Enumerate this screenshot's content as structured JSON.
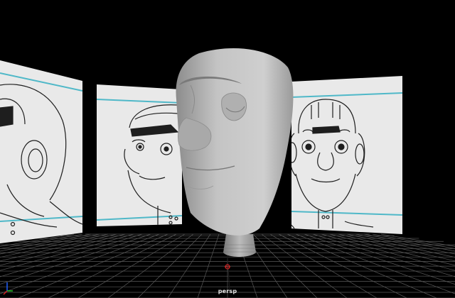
{
  "viewport": {
    "camera_name": "persp",
    "background_color": "#000000",
    "grid_color": "#5a5a5a",
    "accent_line_color": "#4fb8c8",
    "model_color": "#bdbdbd"
  },
  "axis_gizmo": {
    "x_color": "#d02020",
    "y_color": "#20c020",
    "z_color": "#2060ff"
  },
  "image_planes": [
    {
      "name": "side-view-reference",
      "content": "side-profile-sketch"
    },
    {
      "name": "three-quarter-reference",
      "content": "three-quarter-sketch"
    },
    {
      "name": "front-view-reference",
      "content": "front-sketch"
    }
  ]
}
